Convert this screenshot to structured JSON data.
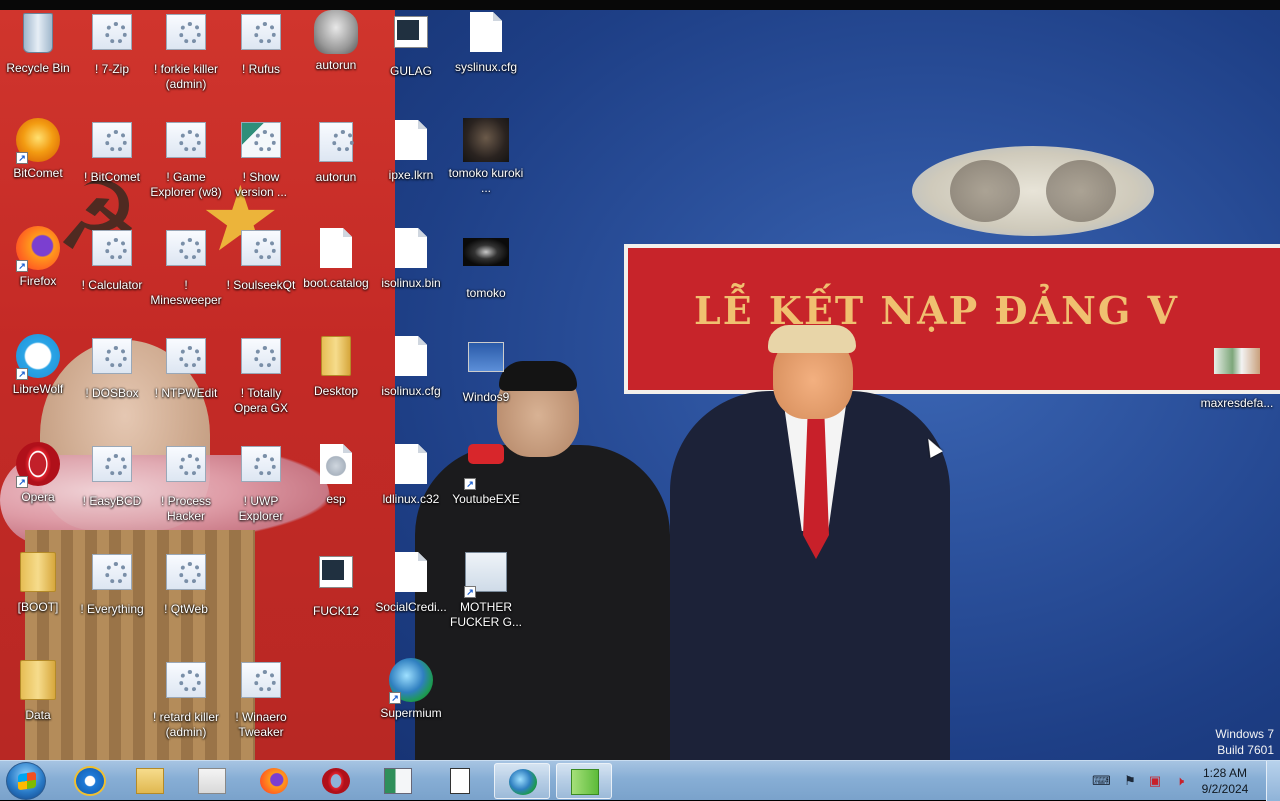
{
  "desktop": {
    "icons": {
      "recycle_bin": "Recycle Bin",
      "seven_zip": "! 7-Zip",
      "forkie_killer": "! forkie killer (admin)",
      "rufus": "! Rufus",
      "autorun_exe": "autorun",
      "gulag": "GULAG",
      "syslinux_cfg": "syslinux.cfg",
      "bitcomet": "BitComet",
      "bitcomet_portable": "! BitComet",
      "game_explorer": "! Game Explorer (w8)",
      "show_version": "! Show version ...",
      "autorun_inf": "autorun",
      "ipxe": "ipxe.lkrn",
      "tomoko_kuroki": "tomoko kuroki ...",
      "firefox": "Firefox",
      "calculator": "! Calculator",
      "minesweeper": "! Minesweeper",
      "soulseek": "! SoulseekQt",
      "boot_catalog": "boot.catalog",
      "isolinux_bin": "isolinux.bin",
      "tomoko": "tomoko",
      "librewolf": "LibreWolf",
      "dosbox": "! DOSBox",
      "ntpwedit": "! NTPWEdit",
      "totally_opera": "! Totally Opera GX",
      "desktop_folder": "Desktop",
      "isolinux_cfg": "isolinux.cfg",
      "windos9": "Windos9",
      "maxresdefault": "maxresdefa...",
      "opera": "Opera",
      "easybcd": "! EasyBCD",
      "process_hacker": "! Process Hacker",
      "uwp_explorer": "! UWP Explorer",
      "esp": "esp",
      "ldlinux": "ldlinux.c32",
      "youtube_exe": "YoutubeEXE",
      "boot_folder": "[BOOT]",
      "everything": "! Everything",
      "qtweb": "! QtWeb",
      "fuck12": "FUCK12",
      "socialcredit": "SocialCredi...",
      "mother_fucker": "MOTHER FUCKER G...",
      "data_folder": "Data",
      "retard_killer": "! retard killer (admin)",
      "winaero": "! Winaero Tweaker",
      "supermium": "Supermium"
    },
    "wallpaper": {
      "banner_text": "LỄ KẾT NẠP ĐẢNG V"
    },
    "watermark": {
      "line1": "Windows 7",
      "line2": "Build 7601"
    }
  },
  "taskbar": {
    "pinned": [
      "internet-explorer",
      "windows-explorer",
      "media-player",
      "firefox",
      "opera",
      "app-window",
      "file",
      "supermium",
      "notepad-plus-plus"
    ],
    "clock": {
      "time": "1:28 AM",
      "date": "9/2/2024"
    }
  },
  "colors": {
    "taskbar": "#87aed5",
    "wallpaper_red": "#c42a26",
    "wallpaper_blue": "#2a4f9a",
    "banner_red": "#c7242a",
    "banner_text": "#f0c070"
  }
}
